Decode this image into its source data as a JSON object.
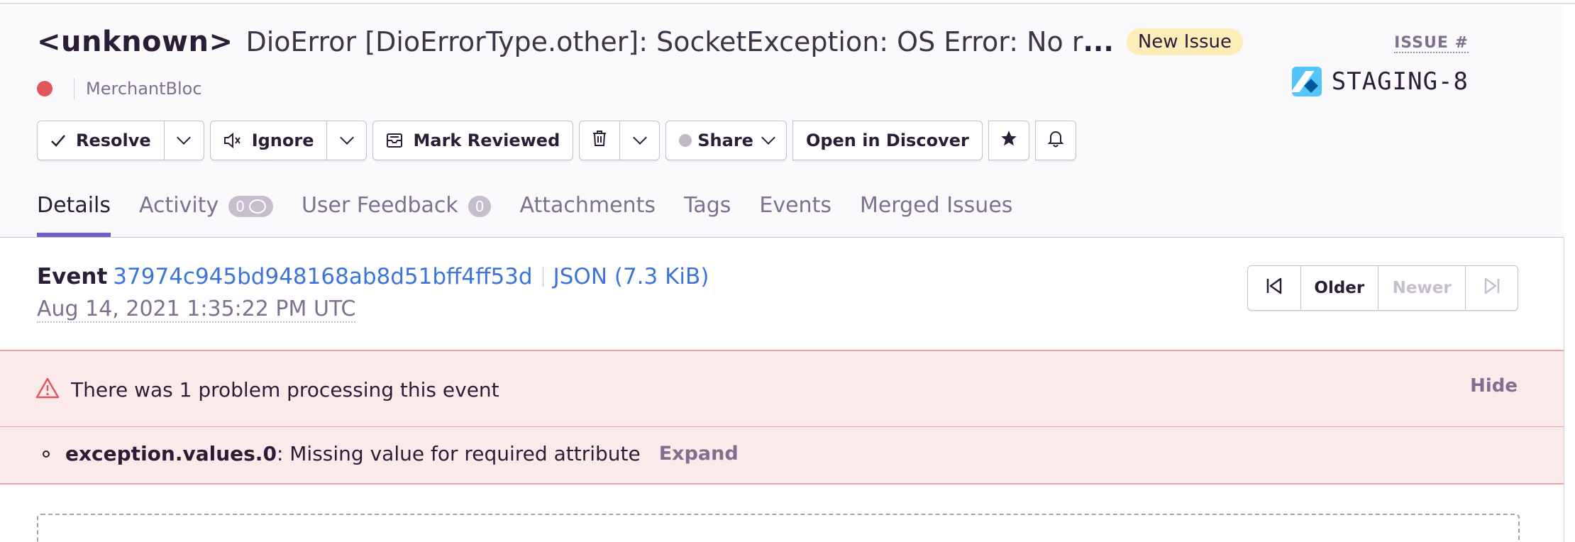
{
  "issue": {
    "type": "<unknown>",
    "message": "DioError [DioErrorType.other]: SocketException: OS Error: No r",
    "ellipsis": "...",
    "badge": "New Issue",
    "project": "MerchantBloc",
    "status_color": "#e1565b",
    "issue_label": "ISSUE #",
    "short_id": "STAGING-8",
    "platform_icon": "flutter-icon"
  },
  "actions": {
    "resolve": "Resolve",
    "ignore": "Ignore",
    "mark_reviewed": "Mark Reviewed",
    "share": "Share",
    "open_discover": "Open in Discover"
  },
  "tabs": [
    {
      "label": "Details",
      "active": true
    },
    {
      "label": "Activity",
      "count": "0"
    },
    {
      "label": "User Feedback",
      "count": "0"
    },
    {
      "label": "Attachments"
    },
    {
      "label": "Tags"
    },
    {
      "label": "Events"
    },
    {
      "label": "Merged Issues"
    }
  ],
  "event": {
    "label": "Event",
    "id": "37974c945bd948168ab8d51bff4ff53d",
    "json": "JSON (7.3 KiB)",
    "date": "Aug 14, 2021 1:35:22 PM UTC"
  },
  "pager": {
    "older": "Older",
    "newer": "Newer"
  },
  "alert": {
    "title": "There was 1 problem processing this event",
    "hide": "Hide",
    "item_key": "exception.values.0",
    "item_msg": ": Missing value for required attribute",
    "expand": "Expand"
  },
  "colors": {
    "accent": "#6c5fc7",
    "link": "#3d74db",
    "error": "#e1565b",
    "badge_bg": "#fdedb8",
    "alert_bg": "#fbeaea"
  }
}
